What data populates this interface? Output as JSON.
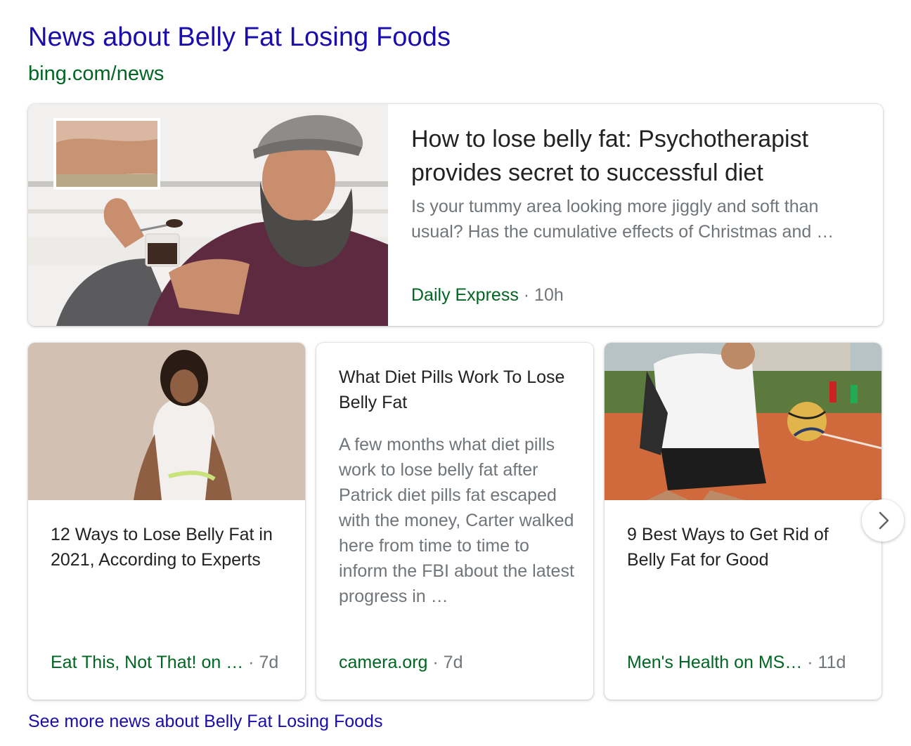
{
  "header": {
    "title": "News about Belly Fat Losing Foods",
    "source_url": "bing.com/news"
  },
  "featured": {
    "image": "man-eating-dessert-photo",
    "headline": "How to lose belly fat: Psychotherapist provides secret to successful diet",
    "snippet": "Is your tummy area looking more jiggly and soft than usual? Has the cumulative effects of Christmas and …",
    "source": "Daily Express",
    "age": "· 10h"
  },
  "cards": [
    {
      "image": "woman-measuring-waist-photo",
      "headline": "12 Ways to Lose Belly Fat in 2021, According to Experts",
      "source": "Eat This, Not That! on …",
      "age": "· 7d"
    },
    {
      "headline": "What Diet Pills Work To Lose Belly Fat",
      "snippet": "A few months what diet pills work to lose belly fat after Patrick diet pills fat escaped with the money, Carter walked here from time to time to inform the FBI about the latest progress in …",
      "source": "camera.org",
      "age": "· 7d"
    },
    {
      "image": "man-playing-basketball-photo",
      "headline": "9 Best Ways to Get Rid of Belly Fat for Good",
      "source": "Men's Health on MS…",
      "age": "· 11d"
    }
  ],
  "navigation": {
    "next_icon": "chevron-right-icon"
  },
  "footer": {
    "see_more": "See more news about Belly Fat Losing Foods"
  },
  "colors": {
    "link": "#1a0dab",
    "source": "#006621",
    "snippet": "#70757a",
    "headline": "#222222"
  }
}
